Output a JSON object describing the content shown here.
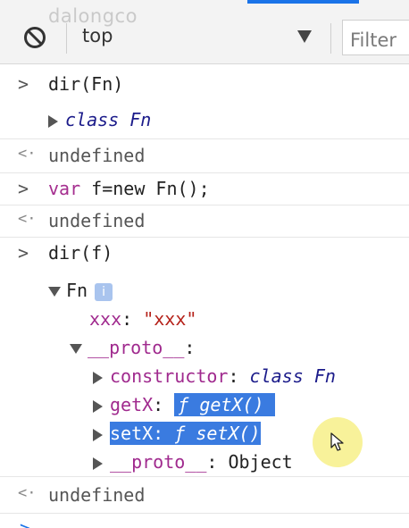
{
  "watermark": "dalongco",
  "toolbar": {
    "clear_icon": "clear-console-icon",
    "context": "top",
    "caret_icon": "caret-down-icon",
    "filter_placeholder": "Filter"
  },
  "console": {
    "input_prompt": ">",
    "result_prompt": "<·",
    "entries": [
      {
        "input": "dir(Fn)"
      },
      {
        "tree_class_keyword": "class",
        "tree_class_name": "Fn"
      },
      {
        "result": "undefined"
      },
      {
        "input_kw": "var",
        "input_rest": " f=new Fn();"
      },
      {
        "result": "undefined"
      },
      {
        "input": "dir(f)"
      }
    ],
    "obj": {
      "name": "Fn",
      "info_badge": "i",
      "xxx_key": "xxx",
      "xxx_value": "\"xxx\"",
      "proto_key": "__proto__",
      "constructor_key": "constructor",
      "constructor_kw": "class",
      "constructor_name": "Fn",
      "getX_key": "getX",
      "getX_value": "ƒ getX()",
      "setX_key": "setX",
      "setX_value": "ƒ setX()",
      "proto2_key": "__proto__",
      "proto2_value": "Object",
      "colon": ":"
    },
    "final_result": "undefined",
    "bottom_prompt": ">"
  },
  "colors": {
    "accent": "#1a73e8",
    "property_key": "#a02a8e",
    "string_value": "#b5221a",
    "selection": "#3a7be0",
    "cursor_highlight": "#f6ee78"
  }
}
